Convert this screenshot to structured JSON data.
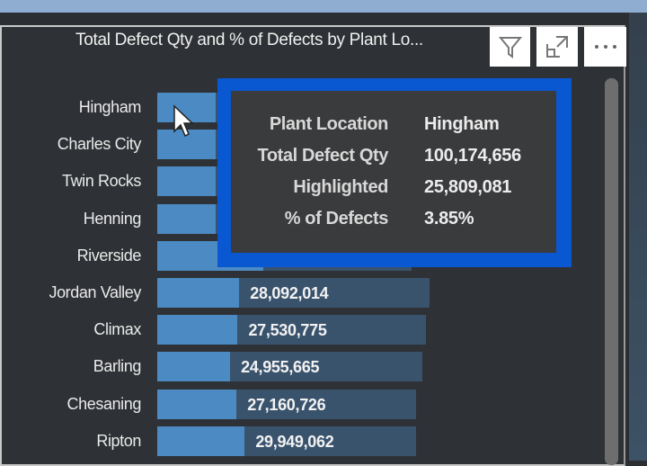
{
  "chart_data": {
    "type": "bar",
    "orientation": "horizontal",
    "title": "Total Defect Qty and % of Defects by Plant Lo...",
    "categories": [
      "Hingham",
      "Charles City",
      "Twin Rocks",
      "Henning",
      "Riverside",
      "Jordan Valley",
      "Climax",
      "Barling",
      "Chesaning",
      "Ripton"
    ],
    "series": [
      {
        "name": "Total Defect Qty",
        "values": [
          100174656,
          null,
          null,
          null,
          null,
          null,
          null,
          null,
          null,
          null
        ]
      },
      {
        "name": "Highlighted",
        "values": [
          25809081,
          null,
          null,
          null,
          null,
          28092014,
          27530775,
          24955665,
          27160726,
          29949062
        ]
      }
    ],
    "visible_data_labels": [
      "",
      "",
      "",
      "",
      "",
      "28,092,014",
      "27,530,775",
      "24,955,665",
      "27,160,726",
      "29,949,062"
    ],
    "colors": {
      "total": "#3a536d",
      "highlighted": "#4b8ac2"
    }
  },
  "header_icons": [
    "filter-icon",
    "focus-mode-icon",
    "more-options-icon"
  ],
  "tooltip": {
    "rows": [
      {
        "key": "Plant Location",
        "value": "Hingham"
      },
      {
        "key": "Total Defect Qty",
        "value": "100,174,656"
      },
      {
        "key": "Highlighted",
        "value": "25,809,081"
      },
      {
        "key": "% of Defects",
        "value": "3.85%"
      }
    ],
    "border_color": "#0a57d2"
  }
}
